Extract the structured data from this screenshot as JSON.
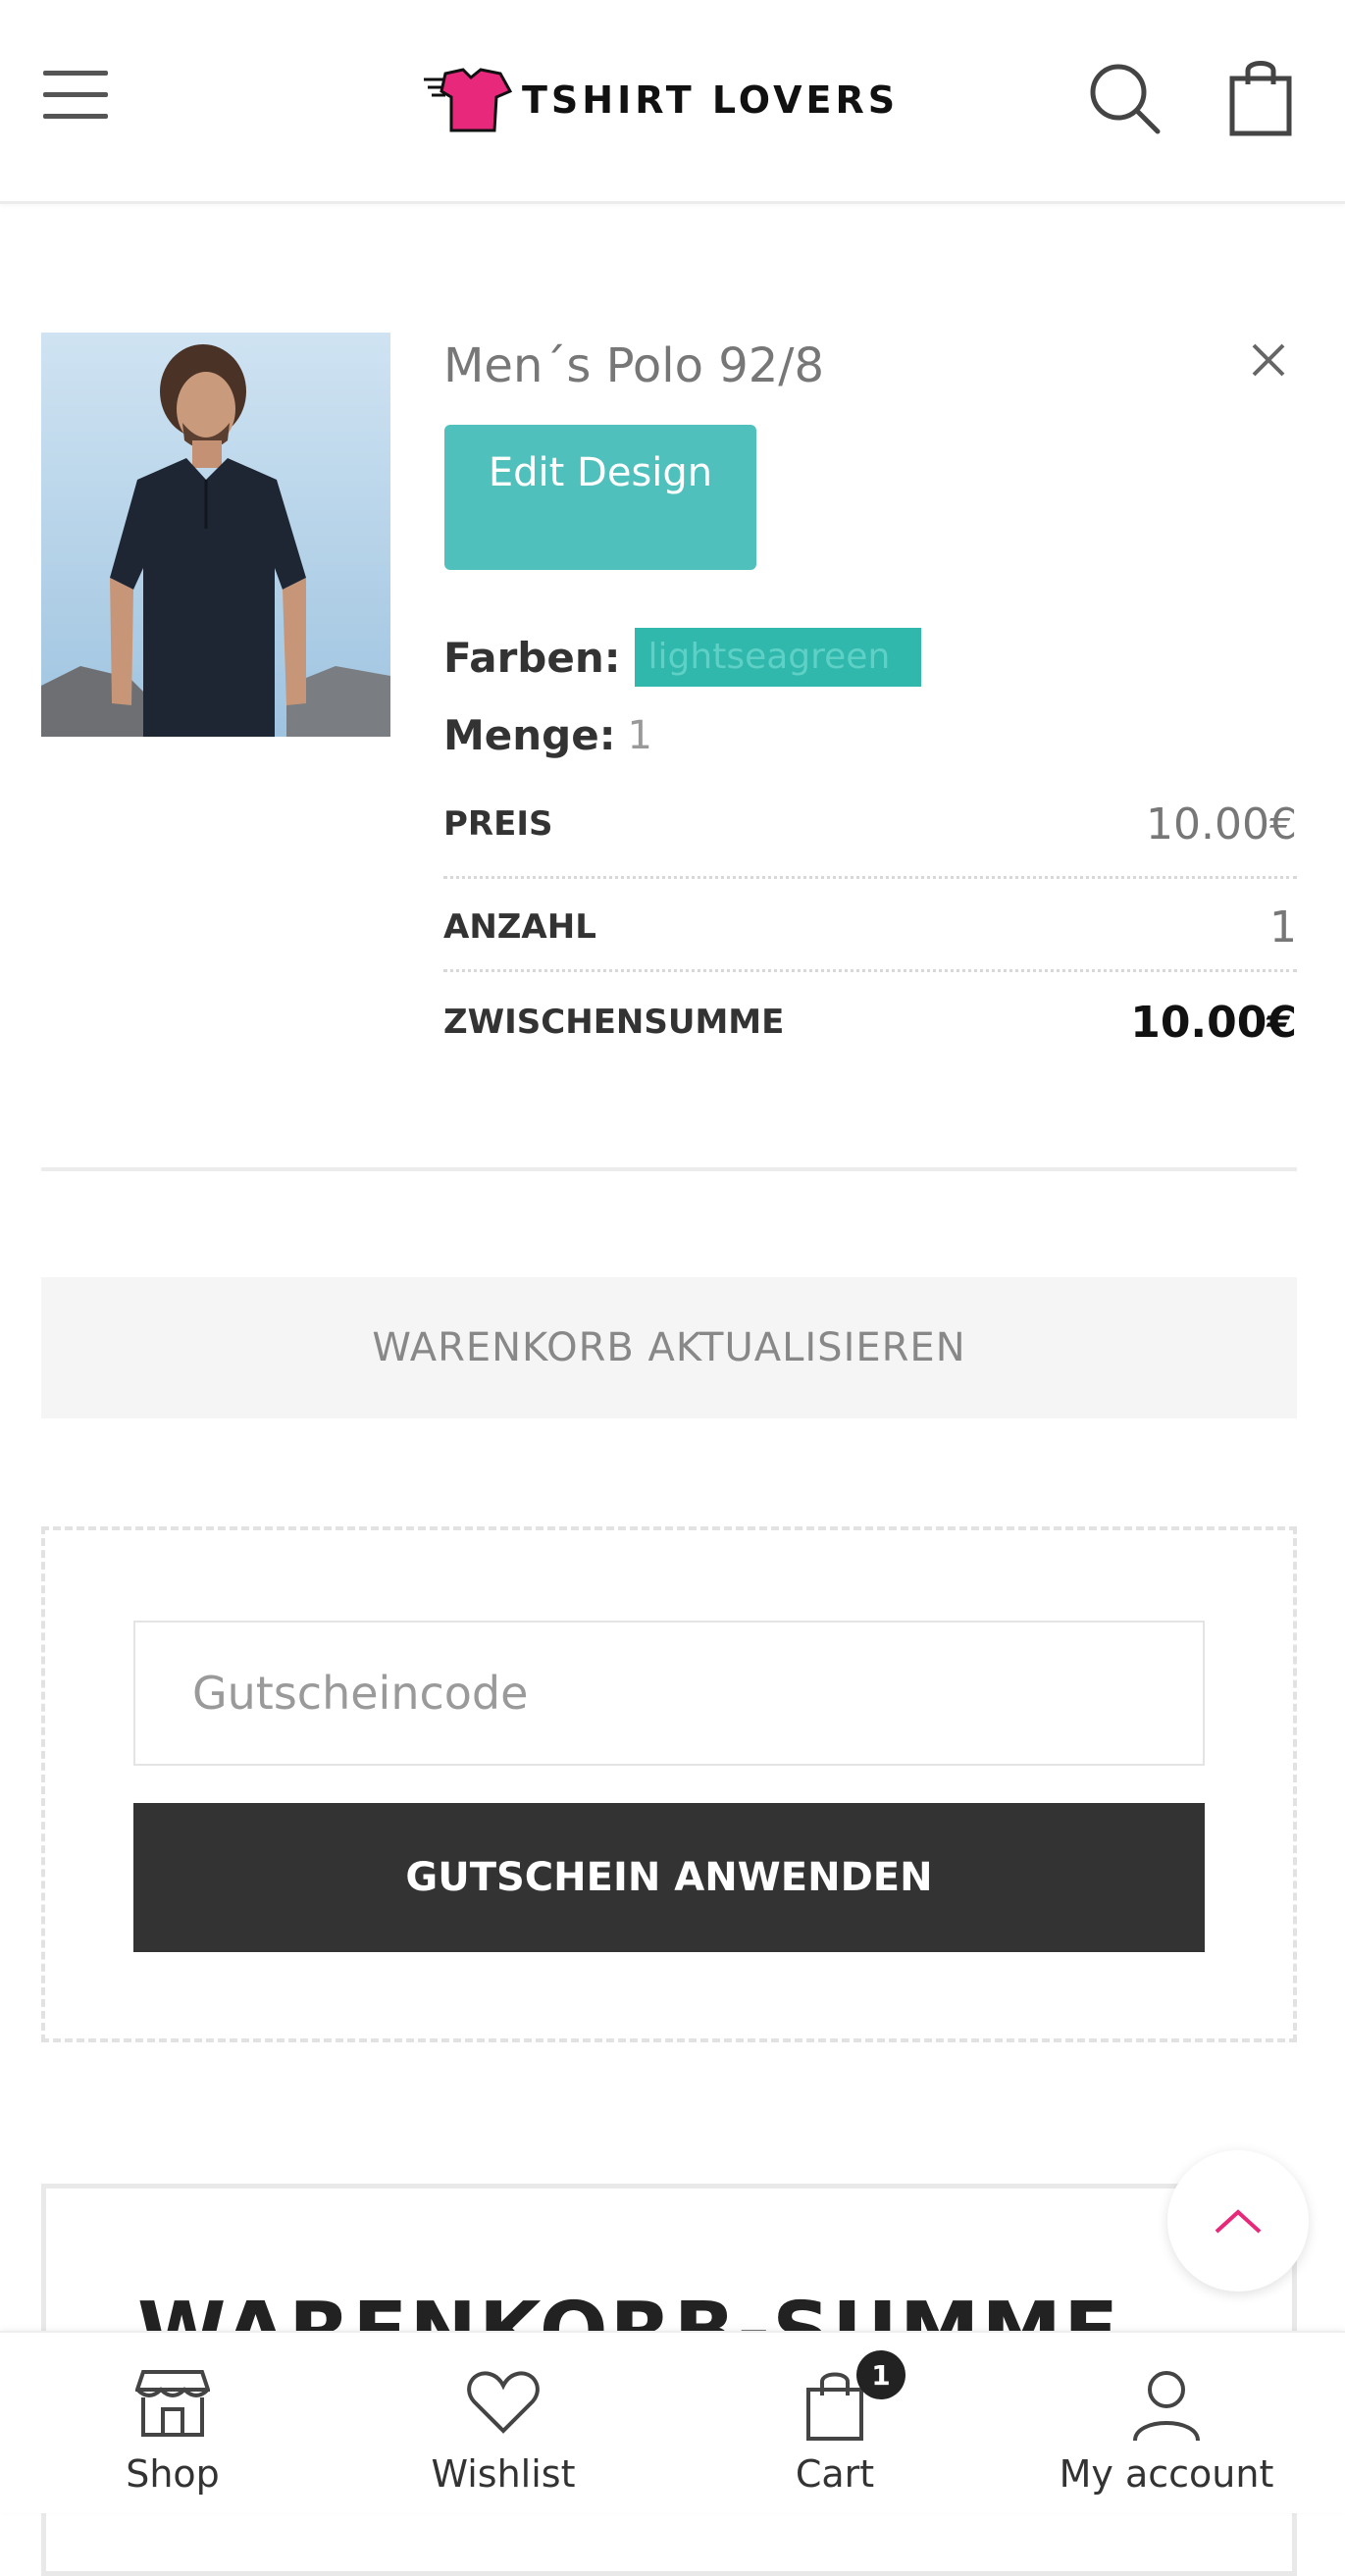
{
  "header": {
    "logo_text": "TSHIRT LOVERS"
  },
  "cart_item": {
    "product_name": "Men´s Polo 92/8",
    "edit_button": "Edit Design",
    "farben_label": "Farben:",
    "farben_value": "lightseagreen",
    "menge_label": "Menge:",
    "menge_value": "1",
    "rows": {
      "preis_label": "PREIS",
      "preis_value": "10.00€",
      "anzahl_label": "ANZAHL",
      "anzahl_value": "1",
      "zwischensumme_label": "ZWISCHENSUMME",
      "zwischensumme_value": "10.00€"
    }
  },
  "update_cart_button": "WARENKORB AKTUALISIEREN",
  "coupon": {
    "placeholder": "Gutscheincode",
    "apply_button": "GUTSCHEIN ANWENDEN"
  },
  "totals": {
    "title": "WARENKORB-SUMME"
  },
  "bottom_nav": {
    "shop": "Shop",
    "wishlist": "Wishlist",
    "cart": "Cart",
    "cart_count": "1",
    "account": "My account"
  },
  "colors": {
    "accent_teal": "#4fc0bc",
    "swatch": "#2fb8ab",
    "logo_pink": "#e8287a",
    "dark_button": "#333333"
  }
}
